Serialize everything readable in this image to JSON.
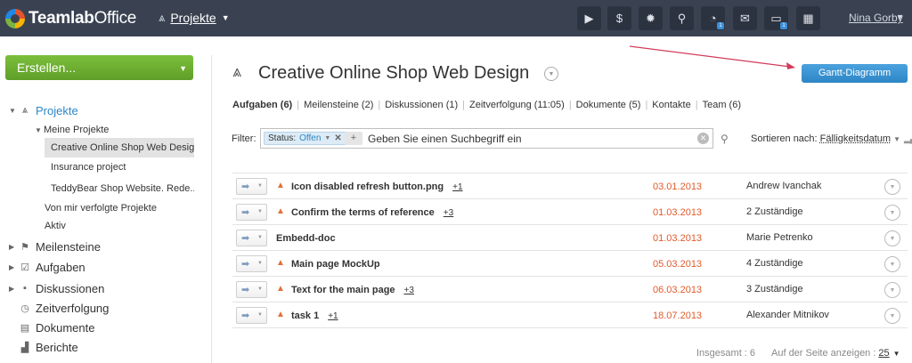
{
  "app": {
    "logo_bold": "Teamlab",
    "logo_rest": "Office",
    "module": "Projekte",
    "user": "Nina Gorby"
  },
  "toolbar": {
    "icons": [
      "video-icon",
      "dollar-icon",
      "gear-icon",
      "search-icon",
      "feed-icon",
      "mail-icon",
      "chat-icon",
      "calendar-icon"
    ]
  },
  "sidebar": {
    "create_label": "Erstellen...",
    "projekte": "Projekte",
    "meine_projekte": "Meine Projekte",
    "projects": [
      "Creative Online Shop Web Design",
      "Insurance project",
      "TeddyBear Shop Website. Rede..."
    ],
    "followed": "Von mir verfolgte Projekte",
    "aktiv": "Aktiv",
    "items": [
      "Meilensteine",
      "Aufgaben",
      "Diskussionen",
      "Zeitverfolgung",
      "Dokumente",
      "Berichte"
    ]
  },
  "main": {
    "title": "Creative Online Shop Web Design",
    "gantt_label": "Gantt-Diagramm",
    "tabs": [
      "Aufgaben (6)",
      "Meilensteine (2)",
      "Diskussionen (1)",
      "Zeitverfolgung (11:05)",
      "Dokumente (5)",
      "Kontakte",
      "Team (6)"
    ],
    "filter_label": "Filter:",
    "status_label": "Status:",
    "status_value": "Offen",
    "search_placeholder": "Geben Sie einen Suchbegriff ein",
    "sort_label": "Sortieren nach:",
    "sort_value": "Fälligkeitsdatum"
  },
  "tasks": [
    {
      "name": "Icon disabled refresh button.png",
      "plus": "+1",
      "date": "03.01.2013",
      "resp": "Andrew Ivanchak",
      "prio": true
    },
    {
      "name": "Confirm the terms of reference",
      "plus": "+3",
      "date": "01.03.2013",
      "resp": "2 Zuständige",
      "prio": true
    },
    {
      "name": "Embedd-doc",
      "plus": "",
      "date": "01.03.2013",
      "resp": "Marie Petrenko",
      "prio": false
    },
    {
      "name": "Main page MockUp",
      "plus": "",
      "date": "05.03.2013",
      "resp": "4 Zuständige",
      "prio": true
    },
    {
      "name": "Text for the main page",
      "plus": "+3",
      "date": "06.03.2013",
      "resp": "3 Zuständige",
      "prio": true
    },
    {
      "name": "task 1",
      "plus": "+1",
      "date": "18.07.2013",
      "resp": "Alexander Mitnikov",
      "prio": true
    }
  ],
  "footer": {
    "total_label": "Insgesamt : 6",
    "per_page_label": "Auf der Seite anzeigen :",
    "per_page_value": "25"
  }
}
